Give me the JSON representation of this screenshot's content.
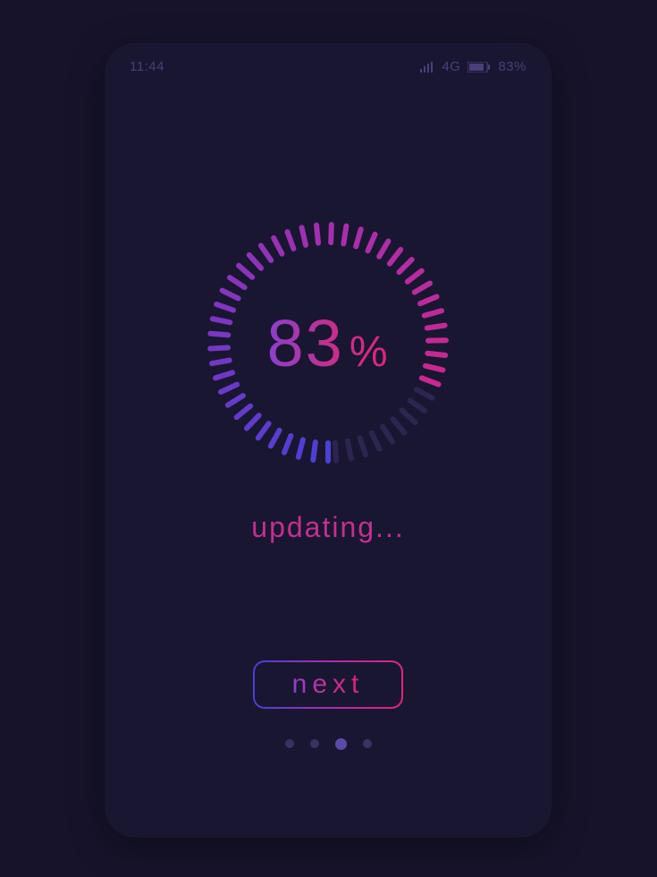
{
  "statusbar": {
    "time": "11:44",
    "network_label": "4G",
    "battery_text": "83%"
  },
  "progress": {
    "percent": 83,
    "percent_text": "83",
    "percent_symbol": "%",
    "status_text": "updating...",
    "ring_segments": 50,
    "colors": {
      "start": "#4a3fd6",
      "mid": "#a42fb0",
      "end": "#e0247a",
      "inactive": "#2c2550"
    }
  },
  "action": {
    "next_label": "next"
  },
  "pager": {
    "count": 4,
    "active_index": 2
  }
}
